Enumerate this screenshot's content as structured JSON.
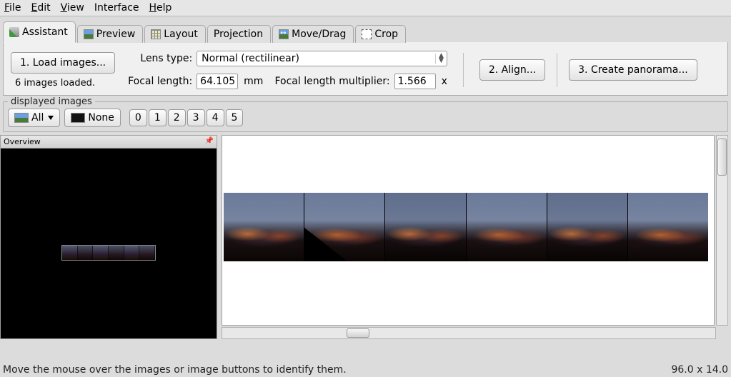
{
  "menu": {
    "file": "File",
    "edit": "Edit",
    "view": "View",
    "interface": "Interface",
    "help": "Help"
  },
  "tabs": {
    "assistant": "Assistant",
    "preview": "Preview",
    "layout": "Layout",
    "projection": "Projection",
    "movedrag": "Move/Drag",
    "crop": "Crop"
  },
  "assistant": {
    "load_btn": "1. Load images...",
    "loaded_text": "6 images loaded.",
    "lens_type_label": "Lens type:",
    "lens_type_value": "Normal (rectilinear)",
    "focal_length_label": "Focal length:",
    "focal_length_value": "64.105",
    "focal_length_unit": "mm",
    "flm_label": "Focal length multiplier:",
    "flm_value": "1.566",
    "flm_unit": "x",
    "align_btn": "2. Align...",
    "create_btn": "3. Create panorama..."
  },
  "display": {
    "legend": "displayed images",
    "all": "All",
    "none": "None",
    "numbers": [
      "0",
      "1",
      "2",
      "3",
      "4",
      "5"
    ]
  },
  "overview": {
    "title": "Overview"
  },
  "status": {
    "hint": "Move the mouse over the images or image buttons to identify them.",
    "coords": "96.0 x 14.0"
  }
}
